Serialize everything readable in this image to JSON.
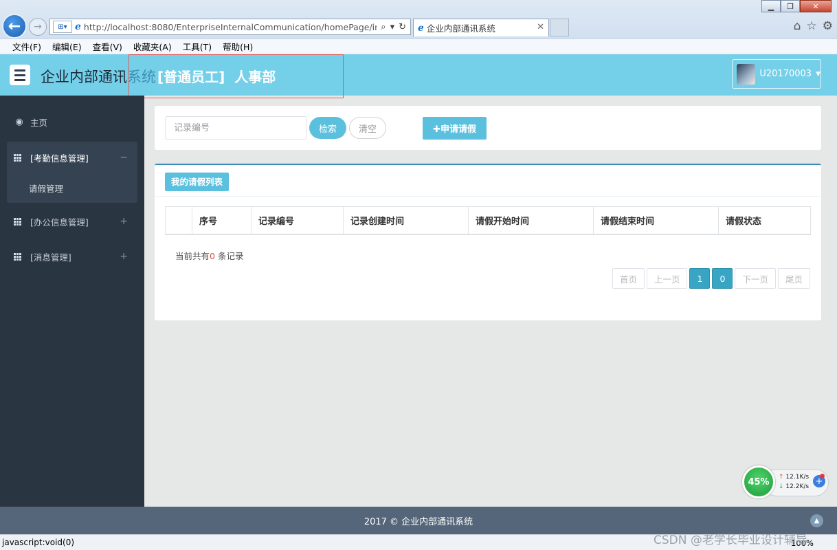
{
  "browser": {
    "address_url": "http://localhost:8080/EnterpriseInternalCommunication/homePage/inde",
    "tab_title": "企业内部通讯系统",
    "menu": [
      "文件(F)",
      "编辑(E)",
      "查看(V)",
      "收藏夹(A)",
      "工具(T)",
      "帮助(H)"
    ],
    "status_text": "javascript:void(0)",
    "zoom": "100%"
  },
  "header": {
    "app_title": "企业内部通讯",
    "app_title_fade": "系统",
    "role": "[普通员工]",
    "department": "人事部",
    "username": "U20170003",
    "accent_color": "#74cfe9"
  },
  "sidebar": {
    "items": [
      {
        "label": "主页",
        "icon": "dashboard-icon"
      },
      {
        "label": "[考勤信息管理]",
        "icon": "grid-icon",
        "expanded": true,
        "toggle": "−",
        "children": [
          {
            "label": "请假管理"
          }
        ]
      },
      {
        "label": "[办公信息管理]",
        "icon": "grid-icon",
        "toggle": "+"
      },
      {
        "label": "[消息管理]",
        "icon": "grid-icon",
        "toggle": "+"
      }
    ]
  },
  "search": {
    "placeholder": "记录编号",
    "search_label": "检索",
    "clear_label": "清空",
    "apply_label": "申请请假"
  },
  "list": {
    "title": "我的请假列表",
    "columns": [
      "",
      "序号",
      "记录编号",
      "记录创建时间",
      "请假开始时间",
      "请假结束时间",
      "请假状态"
    ],
    "count_prefix": "当前共有",
    "count": "0",
    "count_suffix": " 条记录"
  },
  "pager": {
    "first": "首页",
    "prev": "上一页",
    "current": "1",
    "total": "0",
    "next": "下一页",
    "last": "尾页"
  },
  "footer": {
    "text": "2017 © 企业内部通讯系统"
  },
  "netmon": {
    "percent": "45%",
    "up_rate": "12.1K/s",
    "down_rate": "12.2K/s"
  },
  "watermark": "CSDN @老学长毕业设计辅导"
}
